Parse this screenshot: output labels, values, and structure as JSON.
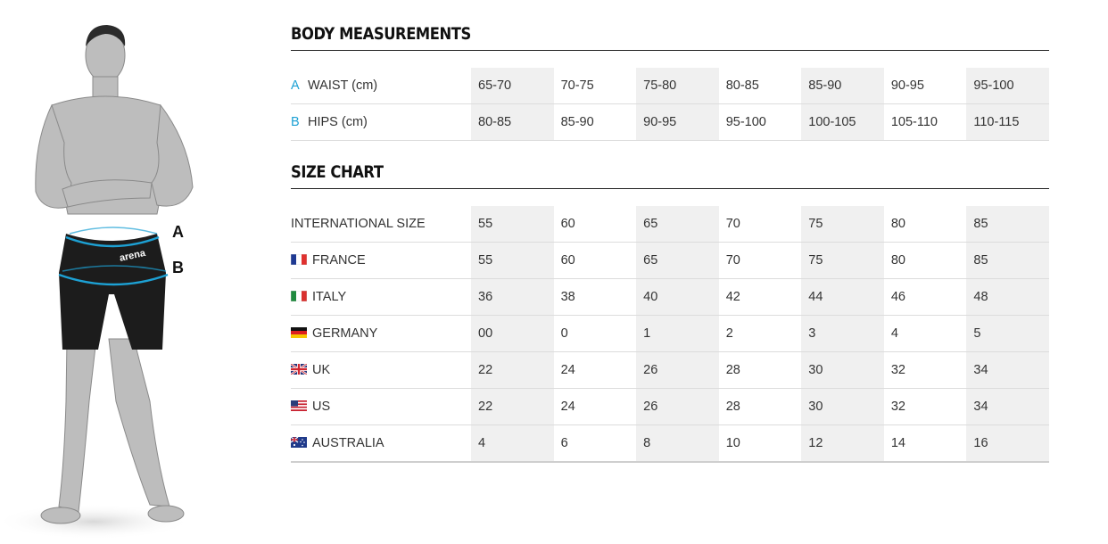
{
  "figure": {
    "marker_a": "A",
    "marker_b": "B",
    "brand_on_shorts": "arena",
    "accent_color": "#1da1d4"
  },
  "body_measurements": {
    "title": "BODY MEASUREMENTS",
    "rows": [
      {
        "letter": "A",
        "label": "WAIST (cm)",
        "values": [
          "65-70",
          "70-75",
          "75-80",
          "80-85",
          "85-90",
          "90-95",
          "95-100"
        ]
      },
      {
        "letter": "B",
        "label": "HIPS (cm)",
        "values": [
          "80-85",
          "85-90",
          "90-95",
          "95-100",
          "100-105",
          "105-110",
          "110-115"
        ]
      }
    ]
  },
  "size_chart": {
    "title": "SIZE CHART",
    "rows": [
      {
        "flag": "",
        "label": "INTERNATIONAL SIZE",
        "values": [
          "55",
          "60",
          "65",
          "70",
          "75",
          "80",
          "85"
        ]
      },
      {
        "flag": "france-flag-icon",
        "label": "FRANCE",
        "values": [
          "55",
          "60",
          "65",
          "70",
          "75",
          "80",
          "85"
        ]
      },
      {
        "flag": "italy-flag-icon",
        "label": "ITALY",
        "values": [
          "36",
          "38",
          "40",
          "42",
          "44",
          "46",
          "48"
        ]
      },
      {
        "flag": "germany-flag-icon",
        "label": "GERMANY",
        "values": [
          "00",
          "0",
          "1",
          "2",
          "3",
          "4",
          "5"
        ]
      },
      {
        "flag": "uk-flag-icon",
        "label": "UK",
        "values": [
          "22",
          "24",
          "26",
          "28",
          "30",
          "32",
          "34"
        ]
      },
      {
        "flag": "us-flag-icon",
        "label": "US",
        "values": [
          "22",
          "24",
          "26",
          "28",
          "30",
          "32",
          "34"
        ]
      },
      {
        "flag": "australia-flag-icon",
        "label": "AUSTRALIA",
        "values": [
          "4",
          "6",
          "8",
          "10",
          "12",
          "14",
          "16"
        ]
      }
    ]
  }
}
